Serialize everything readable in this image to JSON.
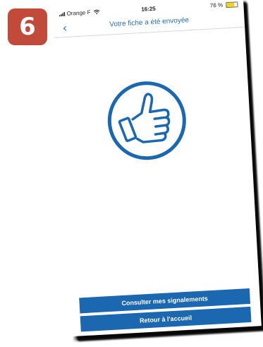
{
  "step": {
    "number": "6"
  },
  "status_bar": {
    "carrier": "Orange F",
    "time": "16:25",
    "battery": "76 %",
    "battery_level": 0.76
  },
  "nav": {
    "title": "Votre fiche a été envoyée"
  },
  "icons": {
    "back": "chevron-left-icon",
    "success": "thumbs-up-icon",
    "signal": "signal-icon",
    "wifi": "wifi-icon",
    "battery": "battery-icon"
  },
  "actions": {
    "reports_label": "Consulter mes signalements",
    "home_label": "Retour à l'accueil"
  },
  "colors": {
    "accent": "#1b67b0",
    "badge": "#c24a3b",
    "battery_fill": "#f2d31b"
  }
}
